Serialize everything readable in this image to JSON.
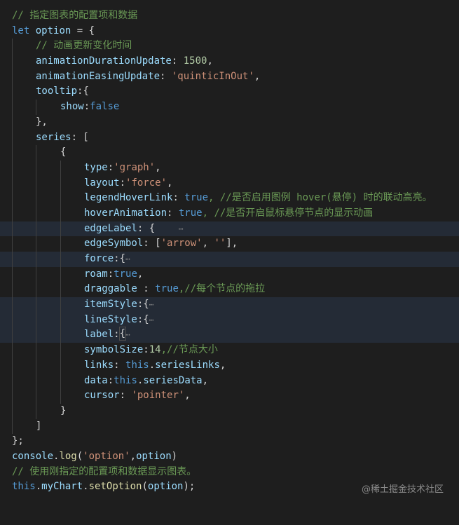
{
  "code": {
    "comment_top": "// 指定图表的配置项和数据",
    "kw_let": "let",
    "var_option": "option",
    "eq_brace": " = {",
    "comment_anim": "// 动画更新变化时间",
    "prop_animDuration": "animationDurationUpdate",
    "colon_sp": ": ",
    "num_1500": "1500",
    "comma": ",",
    "prop_animEasing": "animationEasingUpdate",
    "str_quintic": "'quinticInOut'",
    "prop_tooltip": "tooltip",
    "colon_brace": ":{",
    "prop_show": "show",
    "colon": ":",
    "kw_false": "false",
    "close_brace_comma": "},",
    "prop_series": "series",
    "colon_bracket": ": [",
    "open_brace": "{",
    "prop_type": "type",
    "str_graph": "'graph'",
    "prop_layout": "layout",
    "str_force": "'force'",
    "prop_legendHoverLink": "legendHoverLink",
    "kw_true": "true",
    "comment_legend": ", //是否启用图例 hover(悬停) 时的联动高亮。",
    "prop_hoverAnimation": "hoverAnimation",
    "comment_hover": ", //是否开启鼠标悬停节点的显示动画",
    "prop_edgeLabel": "edgeLabel",
    "colon_sp_brace": ": {",
    "ellipsis": "⋯",
    "prop_edgeSymbol": "edgeSymbol",
    "open_bracket": "[",
    "str_arrow": "'arrow'",
    "comma_sp": ", ",
    "str_empty": "''",
    "close_bracket_comma": "],",
    "prop_force": "force",
    "prop_roam": "roam",
    "prop_draggable": "draggable",
    "sp_colon_sp": " : ",
    "comment_drag": ",//每个节点的拖拉",
    "prop_itemStyle": "itemStyle",
    "prop_lineStyle": "lineStyle",
    "prop_label": "label",
    "prop_symbolSize": "symbolSize",
    "num_14": "14",
    "comment_size": ",//节点大小",
    "prop_links": "links",
    "kw_this": "this",
    "dot": ".",
    "prop_seriesLinks": "seriesLinks",
    "prop_data": "data",
    "prop_seriesData": "seriesData",
    "prop_cursor": "cursor",
    "str_pointer": "'pointer'",
    "close_brace": "}",
    "close_bracket": "]",
    "close_brace_semi": "};",
    "id_console": "console",
    "fn_log": "log",
    "open_paren": "(",
    "str_option": "'option'",
    "close_paren": ")",
    "comment_use": "// 使用刚指定的配置项和数据显示图表。",
    "prop_myChart": "myChart",
    "fn_setOption": "setOption",
    "close_paren_semi": ");"
  },
  "watermark": "@稀土掘金技术社区",
  "colors": {
    "background": "#1e1e1e",
    "comment": "#6a9955",
    "keyword": "#569cd6",
    "property": "#9cdcfe",
    "string": "#ce9178",
    "number": "#b5cea8",
    "function": "#dcdcaa",
    "highlight_row": "#242b36"
  }
}
